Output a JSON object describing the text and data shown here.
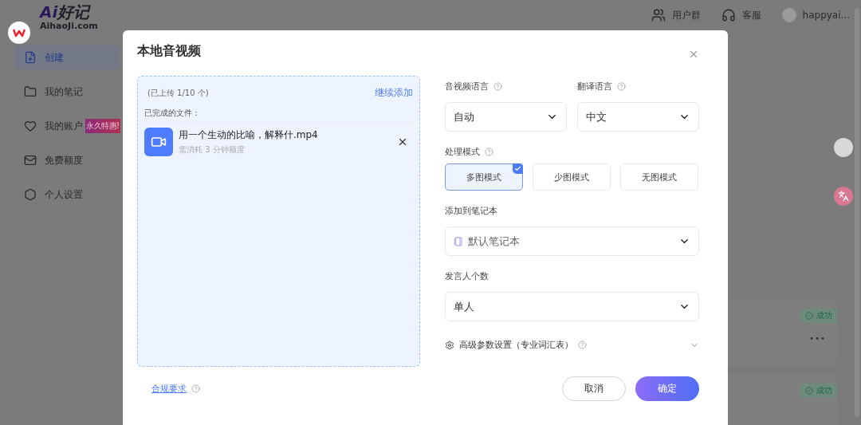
{
  "app": {
    "logo_ai": "Ai",
    "logo_name": "好记",
    "domain": "AihaoJi.com"
  },
  "header": {
    "links": [
      {
        "label": "用户群",
        "kind": "group"
      },
      {
        "label": "客服",
        "kind": "support"
      }
    ],
    "user": "happyai..."
  },
  "sidebar": {
    "items": [
      {
        "label": "创建",
        "kind": "create",
        "selected": true
      },
      {
        "label": "我的笔记",
        "kind": "notes",
        "selected": false
      },
      {
        "label": "我的账户",
        "kind": "account",
        "selected": false,
        "badge": "永久特惠!"
      },
      {
        "label": "免费额度",
        "kind": "quota",
        "selected": false
      },
      {
        "label": "个人设置",
        "kind": "settings",
        "selected": false
      }
    ]
  },
  "background_cards": [
    {
      "status": "成功",
      "more": "•••"
    },
    {
      "status": "成功"
    }
  ],
  "dialog": {
    "title": "本地音视频",
    "upload": {
      "count": "(已上传 1/10 个)",
      "add_more": "继续添加",
      "section": "已完成的文件：",
      "files": [
        {
          "name": "用一个生动的比喻，解释什.mp4",
          "cost": "需消耗 3 分钟额度"
        }
      ]
    },
    "languages": [
      {
        "label": "音视频语言",
        "value": "自动"
      },
      {
        "label": "翻译语言",
        "value": "中文"
      }
    ],
    "mode": {
      "label": "处理模式",
      "options": [
        {
          "label": "多图模式",
          "selected": true
        },
        {
          "label": "少图模式",
          "selected": false
        },
        {
          "label": "无图模式",
          "selected": false
        }
      ]
    },
    "notebook": {
      "label": "添加到笔记本",
      "value": "默认笔记本"
    },
    "speakers": {
      "label": "发言人个数",
      "value": "单人"
    },
    "advanced": {
      "label": "高级参数设置（专业词汇表）",
      "expanded": false
    },
    "footer": {
      "link": "合规要求",
      "cancel": "取消",
      "confirm": "确定"
    }
  }
}
